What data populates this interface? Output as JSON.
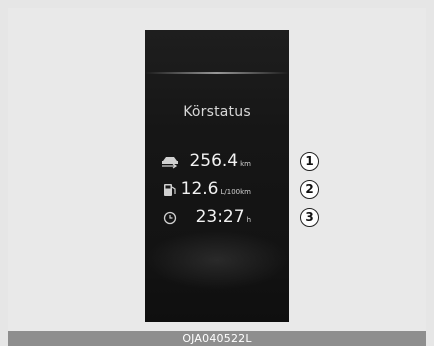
{
  "screen": {
    "title": "Körstatus"
  },
  "trip_rows": [
    {
      "icon": "distance-icon",
      "value": "256.4",
      "unit": "km",
      "callout": "1"
    },
    {
      "icon": "fuel-pump-icon",
      "value": "12.6",
      "unit": "L/100km",
      "callout": "2"
    },
    {
      "icon": "clock-icon",
      "value": "23:27",
      "unit": "h",
      "callout": "3"
    }
  ],
  "caption": {
    "code": "OJA040522L"
  },
  "colors": {
    "display_bg": "#161616",
    "text": "#f2f2f2",
    "page_bg": "#e6e6e6",
    "caption_bg": "#8e8e8e"
  }
}
